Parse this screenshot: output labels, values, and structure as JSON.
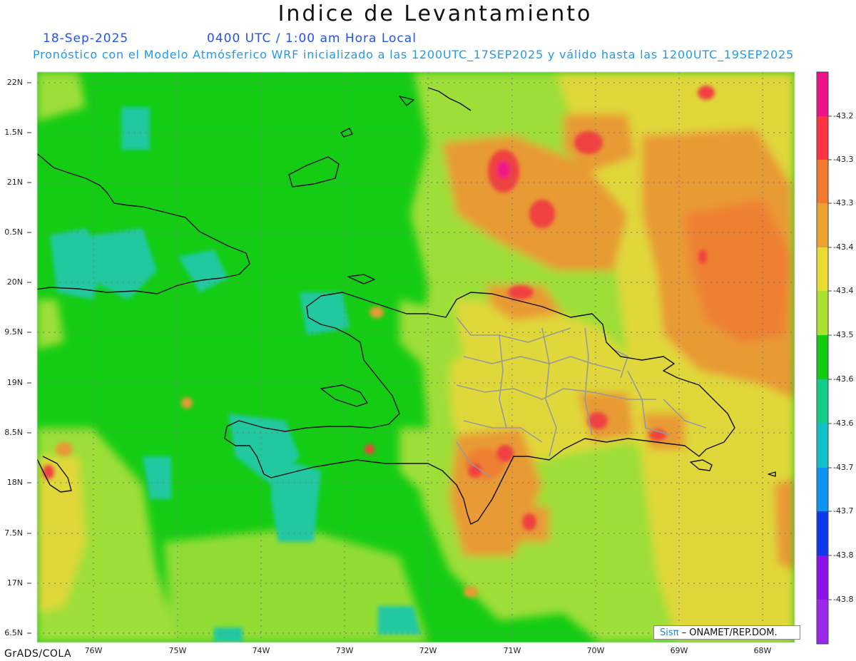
{
  "header": {
    "title": "Indice de Levantamiento",
    "date": "18-Sep-2025",
    "time": "0400 UTC / 1:00 am Hora Local",
    "forecast_info": "Pronóstico con el Modelo Atmósferico WRF inicializado a las 1200UTC_17SEP2025 y válido hasta las  1200UTC_19SEP2025"
  },
  "axes": {
    "lat_labels": [
      "22N",
      "1.5N",
      "21N",
      "0.5N",
      "20N",
      "9.5N",
      "19N",
      "8.5N",
      "18N",
      "7.5N",
      "17N",
      "6.5N"
    ],
    "lon_labels": [
      "76W",
      "75W",
      "74W",
      "73W",
      "72W",
      "71W",
      "70W",
      "69W",
      "68W"
    ]
  },
  "colorbar": {
    "labels": [
      "-43.2",
      "-43.3",
      "-43.3",
      "-43.4",
      "-43.4",
      "-43.5",
      "-43.6",
      "-43.6",
      "-43.7",
      "-43.7",
      "-43.8",
      "-43.8"
    ],
    "colors": [
      "#ee1188",
      "#ff3344",
      "#f07a30",
      "#eaa232",
      "#e8dc30",
      "#aae030",
      "#12cc12",
      "#13cc88",
      "#12c0c8",
      "#1193f0",
      "#1238ee",
      "#8a12e8",
      "#9a28e8"
    ]
  },
  "map_colors": {
    "base": "#14cc14",
    "teal": "#22c8a0",
    "lime": "#9ede38",
    "yellow": "#e0d83a",
    "orange": "#e89a36",
    "deep_orange": "#ee8030",
    "red": "#f04040",
    "magenta": "#ee1288",
    "coast": "#111111",
    "province": "#999999",
    "grid": "#7a7a7a"
  },
  "footer": {
    "credit": "GrADS/COLA",
    "badge_brand": "Sisπ",
    "badge_text": " – ONAMET/REP.DOM."
  }
}
